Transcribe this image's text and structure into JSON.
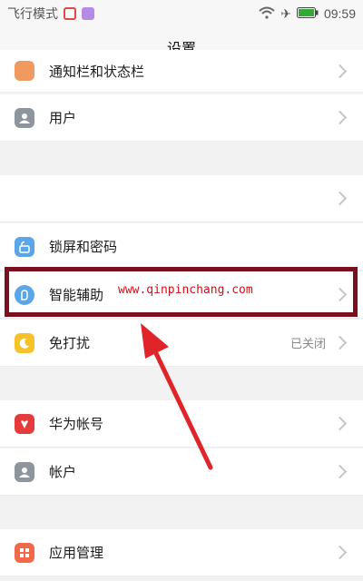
{
  "status_bar": {
    "left_text": "飞行模式",
    "time": "09:59",
    "app_icons": [
      "red-app-icon",
      "purple-app-icon"
    ],
    "right_icons": [
      "wifi-icon",
      "airplane-icon",
      "battery-icon"
    ]
  },
  "title": "设置",
  "settings": {
    "rows": [
      {
        "label": "通知栏和状态栏",
        "icon": "notification-icon",
        "status": ""
      },
      {
        "label": "用户",
        "icon": "user-icon",
        "status": ""
      },
      {
        "label": "",
        "icon": "",
        "status": ""
      },
      {
        "label": "锁屏和密码",
        "icon": "lock-icon",
        "status": ""
      },
      {
        "label": "智能辅助",
        "icon": "smart-assist-icon",
        "status": ""
      },
      {
        "label": "免打扰",
        "icon": "moon-icon",
        "status": "已关闭"
      },
      {
        "label": "华为帐号",
        "icon": "huawei-icon",
        "status": ""
      },
      {
        "label": "帐户",
        "icon": "account-icon",
        "status": ""
      },
      {
        "label": "应用管理",
        "icon": "apps-icon",
        "status": ""
      }
    ]
  },
  "watermark": "www.qinpinchang.com",
  "colors": {
    "highlight_box": "#7a1020",
    "arrow": "#e0252a",
    "watermark": "#d0101a",
    "icon_blue": "#5aa6e8",
    "icon_gray": "#8e959c",
    "icon_orange": "#f0a23a",
    "icon_yellow": "#f5c22a",
    "icon_red": "#e63b3b"
  }
}
